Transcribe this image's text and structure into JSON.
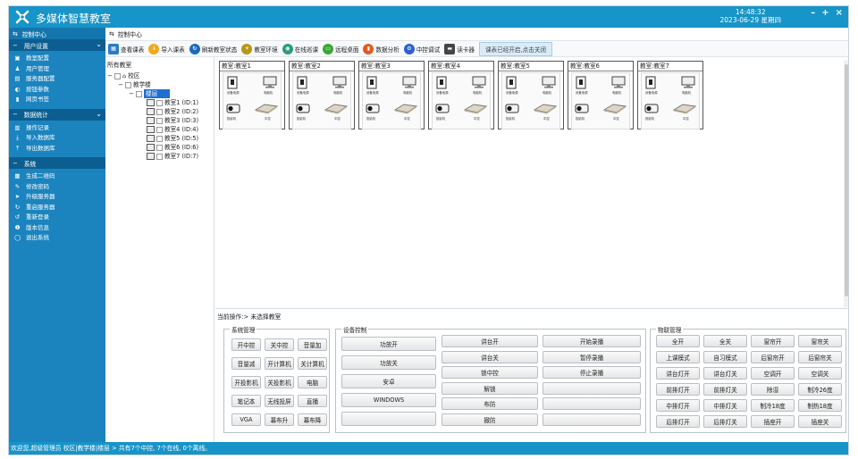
{
  "app": {
    "title": "多媒体智慧教室",
    "time": "14:48:32",
    "date": "2023-06-29 星期四"
  },
  "sidebar": {
    "home": "控制中心",
    "groups": [
      {
        "title": "用户设置",
        "items": [
          {
            "label": "教室配置",
            "icon": "monitor-icon"
          },
          {
            "label": "用户管理",
            "icon": "user-icon"
          },
          {
            "label": "服务器配置",
            "icon": "server-icon"
          },
          {
            "label": "按钮参数",
            "icon": "toggle-icon"
          },
          {
            "label": "网页书签",
            "icon": "bookmark-icon"
          }
        ]
      },
      {
        "title": "数据统计",
        "items": [
          {
            "label": "操作记录",
            "icon": "chart-icon"
          },
          {
            "label": "导入数据库",
            "icon": "import-icon"
          },
          {
            "label": "导出数据库",
            "icon": "export-icon"
          }
        ]
      },
      {
        "title": "系统",
        "items": [
          {
            "label": "生成二维码",
            "icon": "qrcode-icon"
          },
          {
            "label": "修改密码",
            "icon": "wrench-icon"
          },
          {
            "label": "升级服务器",
            "icon": "send-icon"
          },
          {
            "label": "重启服务器",
            "icon": "refresh-icon"
          },
          {
            "label": "重新登录",
            "icon": "undo-icon"
          },
          {
            "label": "版本信息",
            "icon": "info-icon"
          },
          {
            "label": "退出系统",
            "icon": "power-icon"
          }
        ]
      }
    ]
  },
  "crumb": "控制中心",
  "toolbar": {
    "buttons": [
      {
        "label": "查看课表",
        "color": "#2a7cc7",
        "glyph": "▦"
      },
      {
        "label": "导入课表",
        "color": "#f0a81e",
        "glyph": "↓"
      },
      {
        "label": "刷新教室状态",
        "color": "#1d6bb8",
        "glyph": "↻"
      },
      {
        "label": "教室环境",
        "color": "#b89618",
        "glyph": "☀"
      },
      {
        "label": "在线巡课",
        "color": "#2a9c7e",
        "glyph": "◉"
      },
      {
        "label": "远程桌面",
        "color": "#38a832",
        "glyph": "▭"
      },
      {
        "label": "数据分析",
        "color": "#e25b22",
        "glyph": "▮"
      },
      {
        "label": "中控调试",
        "color": "#2f5fd0",
        "glyph": "⚙"
      },
      {
        "label": "读卡器",
        "color": "#444444",
        "glyph": "▬"
      }
    ],
    "status": "课表已经开启,点击关闭"
  },
  "tree": {
    "title": "所有教室",
    "campus": "校区",
    "building": "教学楼",
    "floor": "楼层",
    "rooms": [
      "教室1 (ID:1)",
      "教室2 (ID:2)",
      "教室3 (ID:3)",
      "教室4 (ID:4)",
      "教室5 (ID:5)",
      "教室6 (ID:6)",
      "教室7 (ID:7)"
    ]
  },
  "rooms": [
    {
      "title": "教室:教室1"
    },
    {
      "title": "教室:教室2"
    },
    {
      "title": "教室:教室3"
    },
    {
      "title": "教室:教室4"
    },
    {
      "title": "教室:教室5"
    },
    {
      "title": "教室:教室6"
    },
    {
      "title": "教室:教室7"
    }
  ],
  "device_caps": {
    "power": "设备电源",
    "pc": "电脑机",
    "projector": "投影机",
    "console": "中控"
  },
  "operation": "当前操作:> 未选择教室",
  "system_panel": {
    "title": "系统管理",
    "buttons": [
      [
        "开中控",
        "关中控",
        "音量加"
      ],
      [
        "音量减",
        "开计算机",
        "关计算机"
      ],
      [
        "开投影机",
        "关投影机",
        "电脑"
      ],
      [
        "笔记本",
        "无线投屏",
        "直播"
      ],
      [
        "VGA",
        "幕布升",
        "幕布降"
      ]
    ]
  },
  "device_panel": {
    "title": "设备控制",
    "col1": [
      "功放开",
      "功放关",
      "安卓",
      "WINDOWS",
      ""
    ],
    "col2": [
      "讲台开",
      "讲台关",
      "锁中控",
      "解锁",
      "布防",
      "撤防"
    ],
    "col3": [
      "开始录播",
      "暂停录播",
      "停止录播",
      "",
      "",
      ""
    ]
  },
  "iot_panel": {
    "title": "物联管理",
    "buttons": [
      [
        "全开",
        "全关",
        "窗帘开",
        "窗帘关"
      ],
      [
        "上课模式",
        "自习模式",
        "后窗帘开",
        "后窗帘关"
      ],
      [
        "讲台灯开",
        "讲台灯关",
        "空调开",
        "空调关"
      ],
      [
        "前排灯开",
        "前排灯关",
        "除湿",
        "制冷26度"
      ],
      [
        "中排灯开",
        "中排灯关",
        "制冷18度",
        "制热18度"
      ],
      [
        "后排灯开",
        "后排灯关",
        "插座开",
        "插座关"
      ]
    ]
  },
  "statusbar": "欢迎您,超级管理员  校区|教学楼|楼层 > 共有7个中控, 7个在线, 0个离线。"
}
